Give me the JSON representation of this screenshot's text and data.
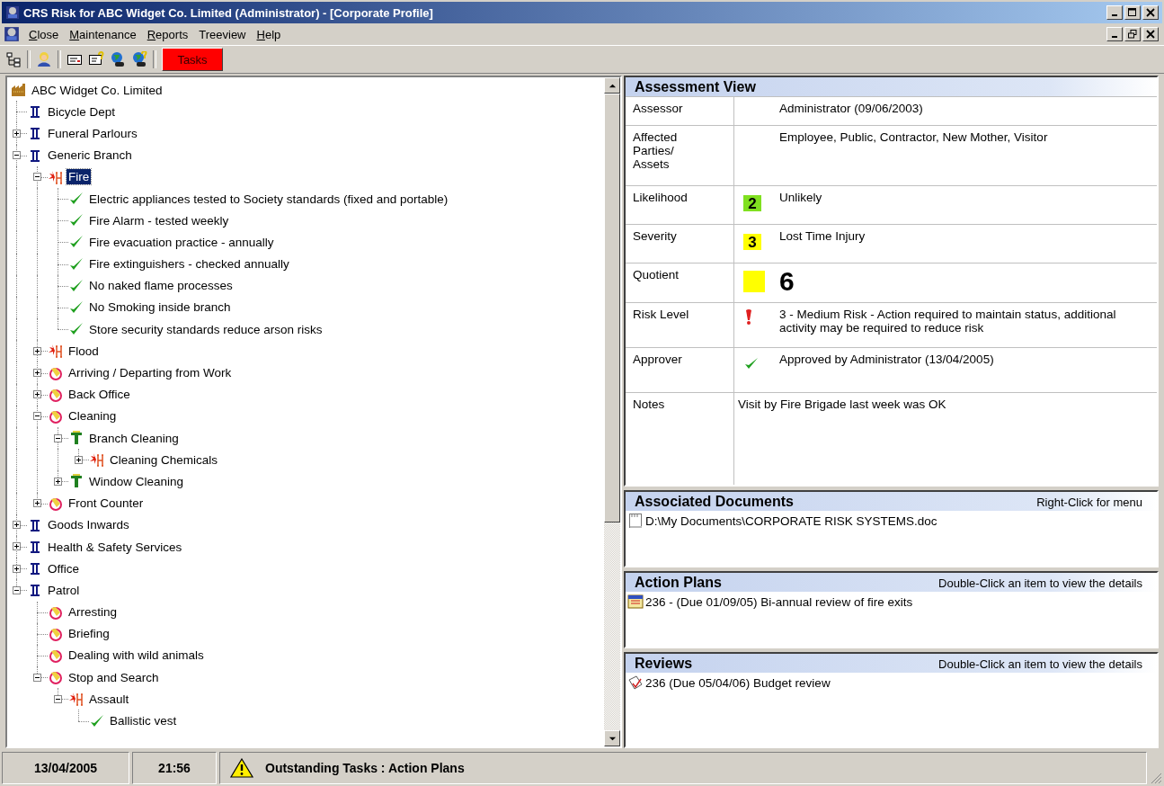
{
  "window": {
    "title": "CRS Risk for ABC Widget Co. Limited (Administrator) - [Corporate Profile]"
  },
  "menu": [
    {
      "label": "Close",
      "mnemonic": true
    },
    {
      "label": "Maintenance",
      "mnemonic": true
    },
    {
      "label": "Reports",
      "mnemonic": true
    },
    {
      "label": "Treeview",
      "mnemonic": false
    },
    {
      "label": "Help",
      "mnemonic": true
    }
  ],
  "toolbar": {
    "tasks_button": "Tasks"
  },
  "tree": [
    {
      "label": "ABC Widget Co. Limited",
      "kind": "org",
      "selected": false,
      "children": [
        {
          "label": "Bicycle Dept",
          "kind": "branch",
          "selected": false
        },
        {
          "label": "Funeral Parlours",
          "kind": "branch",
          "selected": false,
          "expanded": false
        },
        {
          "label": "Generic Branch",
          "kind": "branch",
          "selected": false,
          "expanded": true,
          "children": [
            {
              "label": "Fire",
              "kind": "hazard",
              "selected": true,
              "expanded": true,
              "children": [
                {
                  "label": "Electric appliances tested to Society standards (fixed and portable)",
                  "kind": "control",
                  "selected": false
                },
                {
                  "label": "Fire Alarm - tested weekly",
                  "kind": "control",
                  "selected": false
                },
                {
                  "label": "Fire evacuation practice - annually",
                  "kind": "control",
                  "selected": false
                },
                {
                  "label": "Fire extinguishers - checked annually",
                  "kind": "control",
                  "selected": false
                },
                {
                  "label": "No naked flame processes",
                  "kind": "control",
                  "selected": false
                },
                {
                  "label": "No Smoking inside branch",
                  "kind": "control",
                  "selected": false
                },
                {
                  "label": "Store security standards reduce arson risks",
                  "kind": "control",
                  "selected": false
                }
              ]
            },
            {
              "label": "Flood",
              "kind": "hazard",
              "selected": false,
              "expanded": false
            },
            {
              "label": "Arriving / Departing from Work",
              "kind": "activity",
              "selected": false,
              "expanded": false
            },
            {
              "label": "Back Office",
              "kind": "activity",
              "selected": false,
              "expanded": false
            },
            {
              "label": "Cleaning",
              "kind": "activity",
              "selected": false,
              "expanded": true,
              "children": [
                {
                  "label": "Branch Cleaning",
                  "kind": "task",
                  "selected": false,
                  "expanded": true,
                  "children": [
                    {
                      "label": "Cleaning Chemicals",
                      "kind": "hazard",
                      "selected": false,
                      "expanded": false
                    }
                  ]
                },
                {
                  "label": "Window Cleaning",
                  "kind": "task",
                  "selected": false,
                  "expanded": false
                }
              ]
            },
            {
              "label": "Front Counter",
              "kind": "activity",
              "selected": false,
              "expanded": false
            }
          ]
        },
        {
          "label": "Goods Inwards",
          "kind": "branch",
          "selected": false,
          "expanded": false
        },
        {
          "label": "Health & Safety Services",
          "kind": "branch",
          "selected": false,
          "expanded": false
        },
        {
          "label": "Office",
          "kind": "branch",
          "selected": false,
          "expanded": false
        },
        {
          "label": "Patrol",
          "kind": "branch",
          "selected": false,
          "expanded": true,
          "children": [
            {
              "label": "Arresting",
              "kind": "activity",
              "selected": false
            },
            {
              "label": "Briefing",
              "kind": "activity",
              "selected": false
            },
            {
              "label": "Dealing with wild animals",
              "kind": "activity",
              "selected": false
            },
            {
              "label": "Stop and Search",
              "kind": "activity",
              "selected": false,
              "expanded": true,
              "children": [
                {
                  "label": "Assault",
                  "kind": "hazard",
                  "selected": false,
                  "expanded": true,
                  "children": [
                    {
                      "label": "Ballistic vest",
                      "kind": "control",
                      "selected": false
                    }
                  ]
                }
              ]
            }
          ]
        }
      ]
    }
  ],
  "assessment": {
    "title": "Assessment View",
    "rows": [
      {
        "label": "Assessor",
        "kind": "text",
        "value": "Administrator (09/06/2003)"
      },
      {
        "label": "Affected Parties/ Assets",
        "kind": "text",
        "value": "Employee, Public, Contractor, New Mother, Visitor"
      },
      {
        "label": "Likelihood",
        "kind": "badge",
        "badge": "2",
        "color": "#80e020",
        "value": "Unlikely"
      },
      {
        "label": "Severity",
        "kind": "badge",
        "badge": "3",
        "color": "#ffff00",
        "value": "Lost Time Injury"
      },
      {
        "label": "Quotient",
        "kind": "quotient",
        "color": "#ffff00",
        "value": "6"
      },
      {
        "label": "Risk Level",
        "kind": "warning",
        "value": "3 - Medium Risk - Action required to maintain status, additional activity may be required to reduce risk"
      },
      {
        "label": "Approver",
        "kind": "approved",
        "value": "Approved by Administrator (13/04/2005)"
      },
      {
        "label": "Notes",
        "kind": "notes",
        "value": "Visit by Fire Brigade last week was OK"
      }
    ]
  },
  "panels": [
    {
      "title": "Associated Documents",
      "hint": "Right-Click for menu",
      "kind": "document",
      "items": [
        "D:\\My Documents\\CORPORATE RISK SYSTEMS.doc"
      ]
    },
    {
      "title": "Action Plans",
      "hint": "Double-Click an item to view the details",
      "kind": "plan",
      "items": [
        "236 - (Due 01/09/05) Bi-annual review of fire exits"
      ]
    },
    {
      "title": "Reviews",
      "hint": "Double-Click an item to view the details",
      "kind": "review",
      "items": [
        "236 (Due 05/04/06) Budget review"
      ]
    }
  ],
  "status_bar": {
    "date": "13/04/2005",
    "time": "21:56",
    "message": "Outstanding Tasks : Action Plans"
  }
}
